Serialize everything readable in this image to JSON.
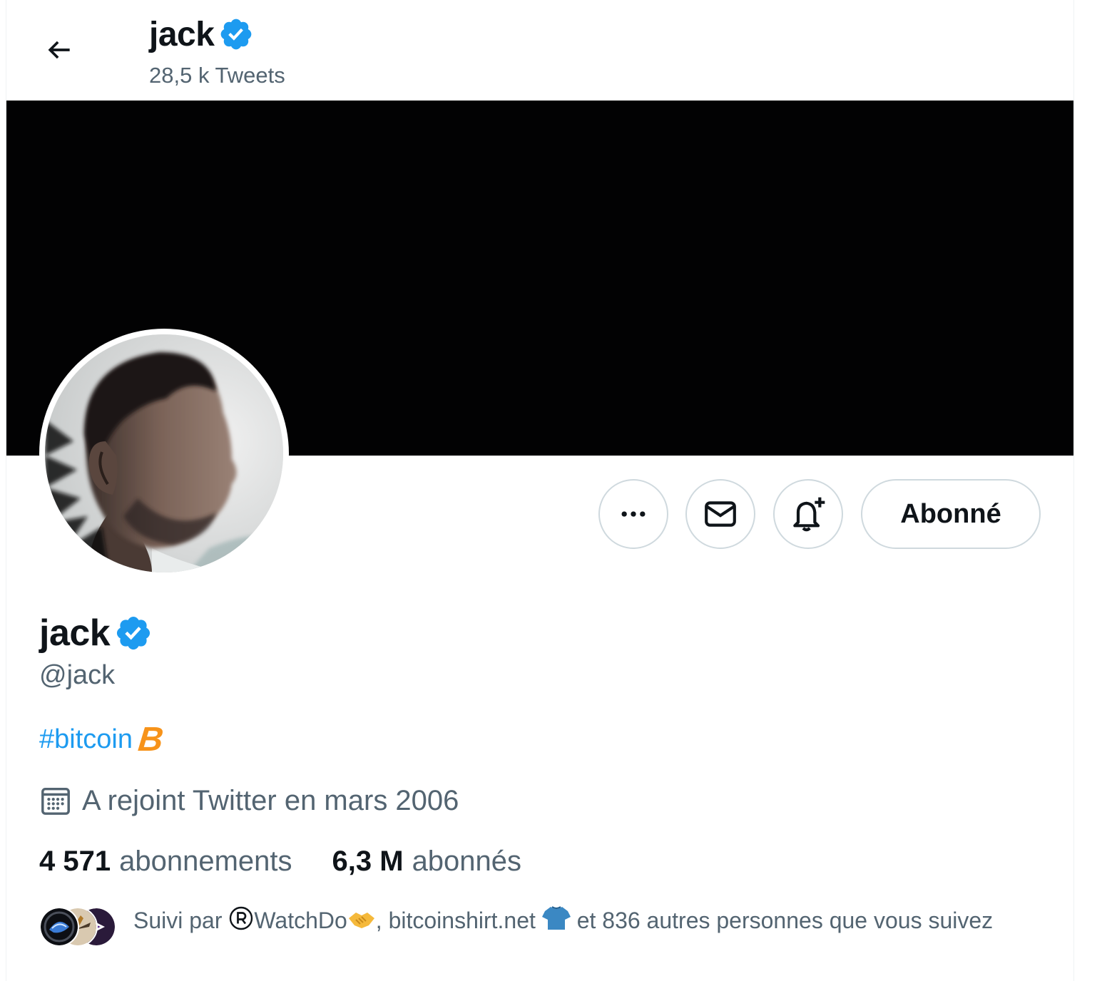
{
  "header": {
    "title": "jack",
    "tweet_count": "28,5 k Tweets",
    "back_icon": "arrow-left-icon"
  },
  "profile": {
    "name": "jack",
    "handle": "@jack",
    "verified": true,
    "bio_hashtag": "#bitcoin",
    "bio_emoji": "B",
    "joined": "A rejoint Twitter en mars 2006",
    "following_count": "4 571",
    "following_label": "abonnements",
    "followers_count": "6,3 M",
    "followers_label": "abonnés"
  },
  "actions": {
    "more_icon": "more-horizontal-icon",
    "message_icon": "envelope-icon",
    "notify_icon": "bell-plus-icon",
    "follow_label": "Abonné"
  },
  "followed_by": {
    "prefix": "Suivi par",
    "user1": "WatchDo",
    "separator": ",",
    "user2": "bitcoinshirt.net",
    "suffix": "et 836 autres personnes que vous suivez"
  },
  "colors": {
    "accent": "#1d9bf0",
    "muted": "#536471",
    "text": "#0f1419",
    "banner": "#020203",
    "bitcoin": "#f7931a"
  }
}
